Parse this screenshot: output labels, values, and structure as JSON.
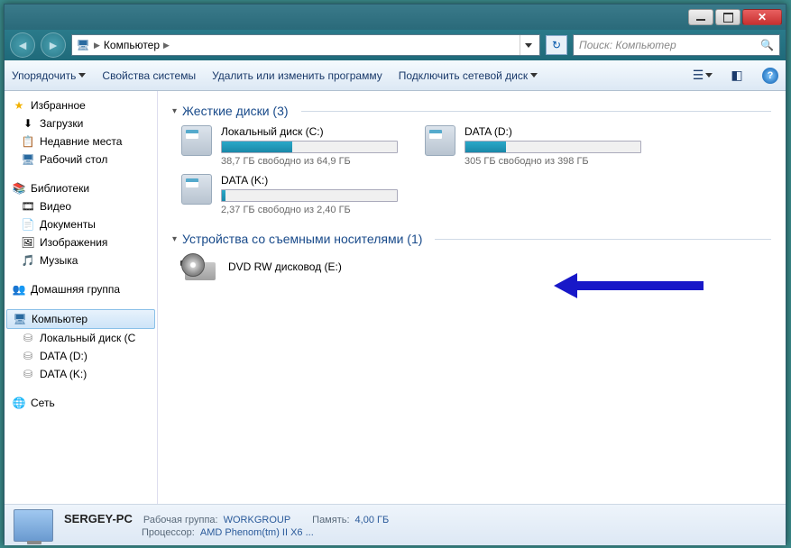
{
  "address": {
    "root": "Компьютер"
  },
  "search": {
    "placeholder": "Поиск: Компьютер"
  },
  "toolbar": {
    "organize": "Упорядочить",
    "properties": "Свойства системы",
    "programs": "Удалить или изменить программу",
    "netdrive": "Подключить сетевой диск"
  },
  "sidebar": {
    "favorites": "Избранное",
    "downloads": "Загрузки",
    "recent": "Недавние места",
    "desktop": "Рабочий стол",
    "libraries": "Библиотеки",
    "video": "Видео",
    "documents": "Документы",
    "pictures": "Изображения",
    "music": "Музыка",
    "homegroup": "Домашняя группа",
    "computer": "Компьютер",
    "localc": "Локальный диск (C",
    "datad": "DATA (D:)",
    "datak": "DATA (K:)",
    "network": "Сеть"
  },
  "sections": {
    "hdd": "Жесткие диски (3)",
    "removable": "Устройства со съемными носителями (1)"
  },
  "drives": [
    {
      "name": "Локальный диск (C:)",
      "free": "38,7 ГБ свободно из 64,9 ГБ",
      "pct": 40
    },
    {
      "name": "DATA (D:)",
      "free": "305 ГБ свободно из 398 ГБ",
      "pct": 23
    },
    {
      "name": "DATA (K:)",
      "free": "2,37 ГБ свободно из 2,40 ГБ",
      "pct": 2
    }
  ],
  "dvd": {
    "name": "DVD RW дисковод (E:)",
    "badge": "DVD"
  },
  "details": {
    "name": "SERGEY-PC",
    "workgroup_label": "Рабочая группа:",
    "workgroup": "WORKGROUP",
    "memory_label": "Память:",
    "memory": "4,00 ГБ",
    "cpu_label": "Процессор:",
    "cpu": "AMD Phenom(tm) II X6 ..."
  }
}
